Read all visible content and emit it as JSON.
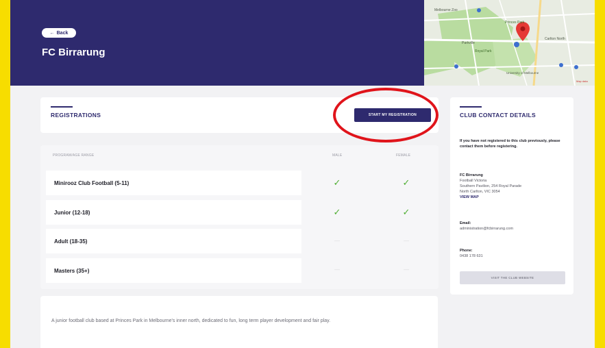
{
  "header": {
    "back_label": "Back",
    "club_name": "FC Birrarung"
  },
  "map": {
    "labels": [
      "Melbourne Zoo",
      "Princes Park",
      "Parkville",
      "Royal Park",
      "Carlton North",
      "University of Melbourne",
      "Map data"
    ]
  },
  "registrations": {
    "title": "REGISTRATIONS",
    "start_button": "START MY REGISTRATION",
    "columns": {
      "program": "PROGRAM/AGE RANGE",
      "male": "MALE",
      "female": "FEMALE"
    },
    "rows": [
      {
        "label": "Minirooz Club Football (5-11)",
        "male": true,
        "female": true
      },
      {
        "label": "Junior (12-18)",
        "male": true,
        "female": true
      },
      {
        "label": "Adult (18-35)",
        "male": false,
        "female": false
      },
      {
        "label": "Masters (35+)",
        "male": false,
        "female": false
      }
    ]
  },
  "contact": {
    "title": "CLUB CONTACT DETAILS",
    "notice": "If you have not registered to this club previously, please contact them before registering.",
    "venue_name": "FC Birrarung",
    "venue_line1": "Football Victoria",
    "venue_line2": "Southern Pavilion, 254 Royal Parade",
    "venue_line3": "North Carlton, VIC 3054",
    "view_map": "VIEW MAP",
    "email_label": "Email:",
    "email_value": "administration@fcbirrarung.com",
    "phone_label": "Phone:",
    "phone_value": "0438 178 631",
    "website_button": "VISIT THE CLUB WEBSITE"
  },
  "about": {
    "text": "A junior football club based at Princes Park in Melbourne's inner north, dedicated to fun, long term player development and fair play."
  },
  "colors": {
    "brand": "#2e2a6e",
    "frame": "#f7dd00",
    "check": "#4fae33",
    "highlight_circle": "#e0141b"
  }
}
